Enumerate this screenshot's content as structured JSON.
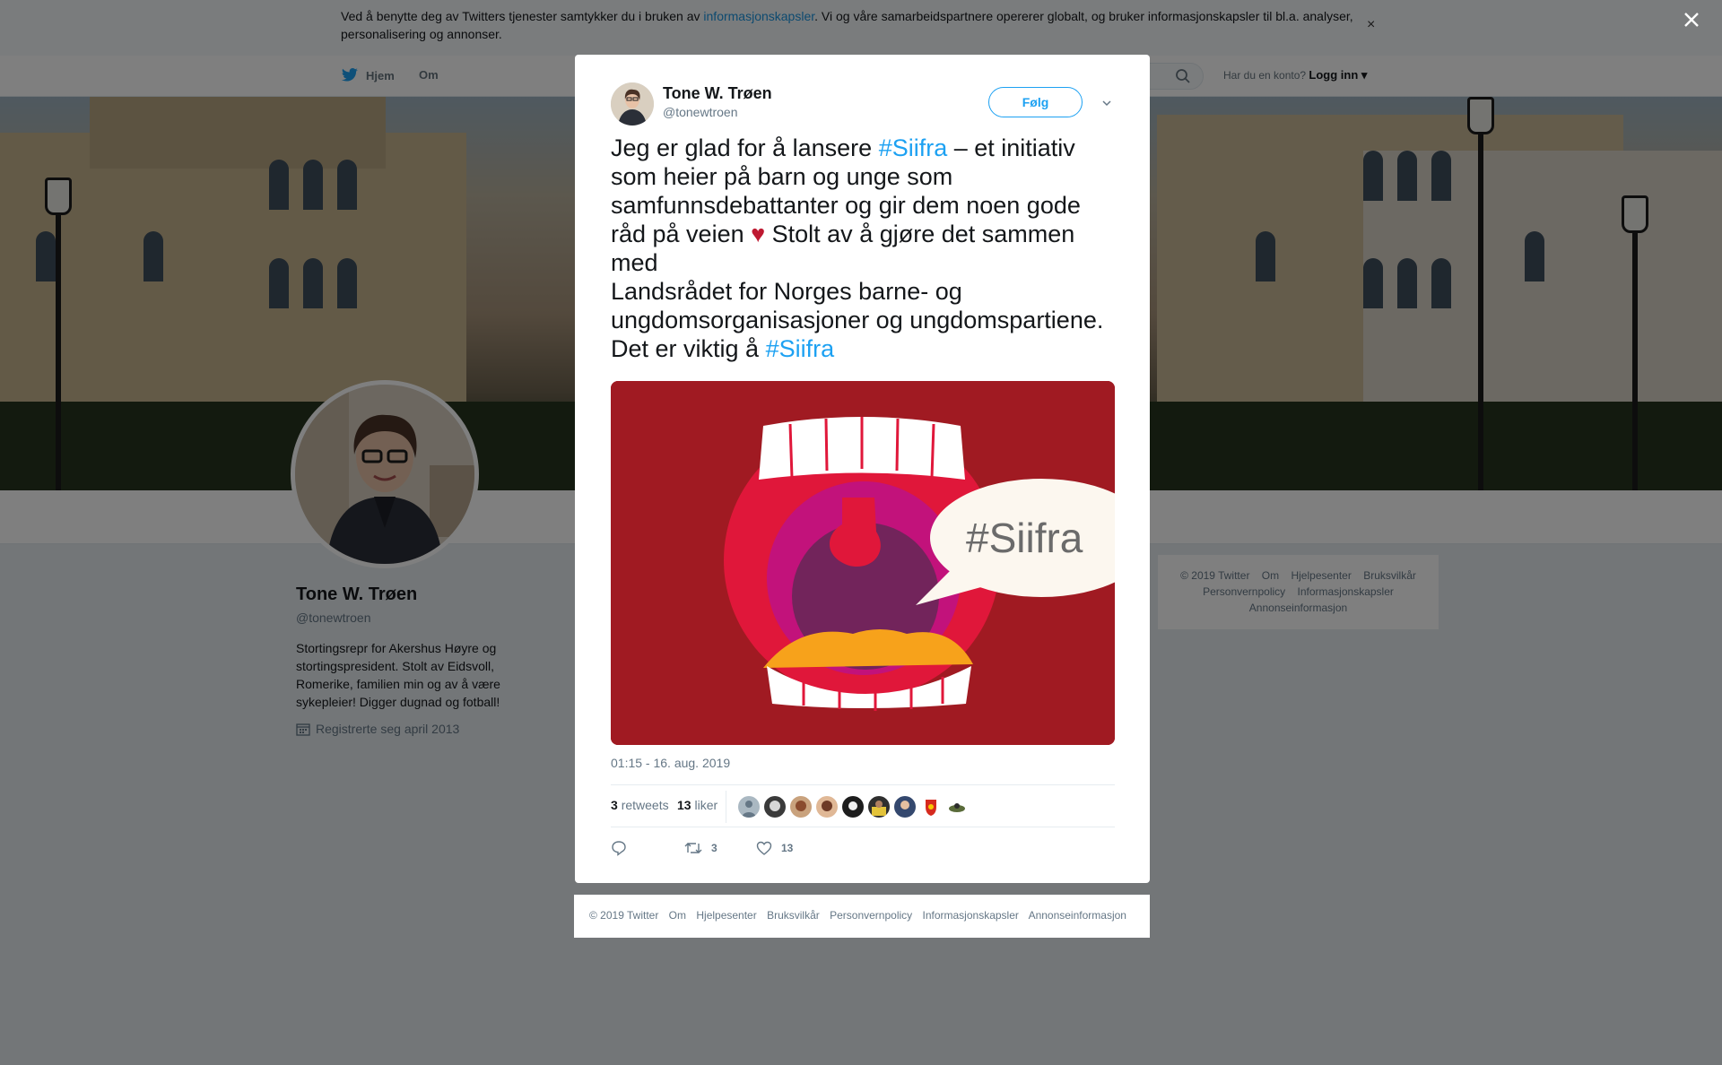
{
  "cookie_banner": {
    "text_before": "Ved å benytte deg av Twitters tjenester samtykker du i bruken av ",
    "link": "informasjonskapsler",
    "text_after": ". Vi og våre samarbeidspartnere opererer globalt, og bruker informasjonskapsler til bl.a. analyser, personalisering og annonser.",
    "close": "×"
  },
  "nav": {
    "home": "Hjem",
    "about": "Om",
    "login_prompt": "Har du en konto?",
    "login": "Logg inn"
  },
  "profile": {
    "name": "Tone W. Trøen",
    "handle": "@tonewtroen",
    "bio": "Stortingsrepr for Akershus Høyre og stortingspresident. Stolt av Eidsvoll, Romerike, familien min og av å være sykepleier! Digger dugnad og fotball!",
    "joined": "Registrerte seg april 2013"
  },
  "side_footer": {
    "row1": [
      "© 2019 Twitter",
      "Om",
      "Hjelpesenter",
      "Bruksvilkår"
    ],
    "row2": [
      "Personvernpolicy",
      "Informasjonskapsler"
    ],
    "row3": [
      "Annonseinformasjon"
    ]
  },
  "tweet": {
    "author_name": "Tone W. Trøen",
    "author_handle": "@tonewtroen",
    "follow_label": "Følg",
    "text": {
      "part1": "Jeg er glad for å lansere ",
      "hashtag1": "#Siifra",
      "part2": " – et initiativ som heier på barn og unge som samfunnsdebattanter og gir dem noen gode råd på veien ",
      "emoji": "♥",
      "part3": " Stolt av å gjøre det sammen med",
      "part4": "Landsrådet for Norges barne- og ungdomsorganisasjoner og ungdomspartiene. Det er viktig å ",
      "hashtag2": "#Siifra"
    },
    "media_text": "#Siifra",
    "timestamp": "01:15 - 16. aug. 2019",
    "retweets_count": "3",
    "retweets_label": "retweets",
    "likes_count": "13",
    "likes_label": "liker",
    "action_retweet_count": "3",
    "action_like_count": "13"
  },
  "modal_footer": [
    "© 2019 Twitter",
    "Om",
    "Hjelpesenter",
    "Bruksvilkår",
    "Personvernpolicy",
    "Informasjonskapsler",
    "Annonseinformasjon"
  ],
  "colors": {
    "twitter_blue": "#1da1f2",
    "link_blue": "#1b95e0",
    "media_red": "#a01a22"
  },
  "icons": [
    "twitter-bird-icon",
    "search-icon",
    "close-icon",
    "chevron-down-icon",
    "calendar-icon",
    "reply-icon",
    "retweet-icon",
    "like-icon",
    "heart-emoji-icon"
  ]
}
